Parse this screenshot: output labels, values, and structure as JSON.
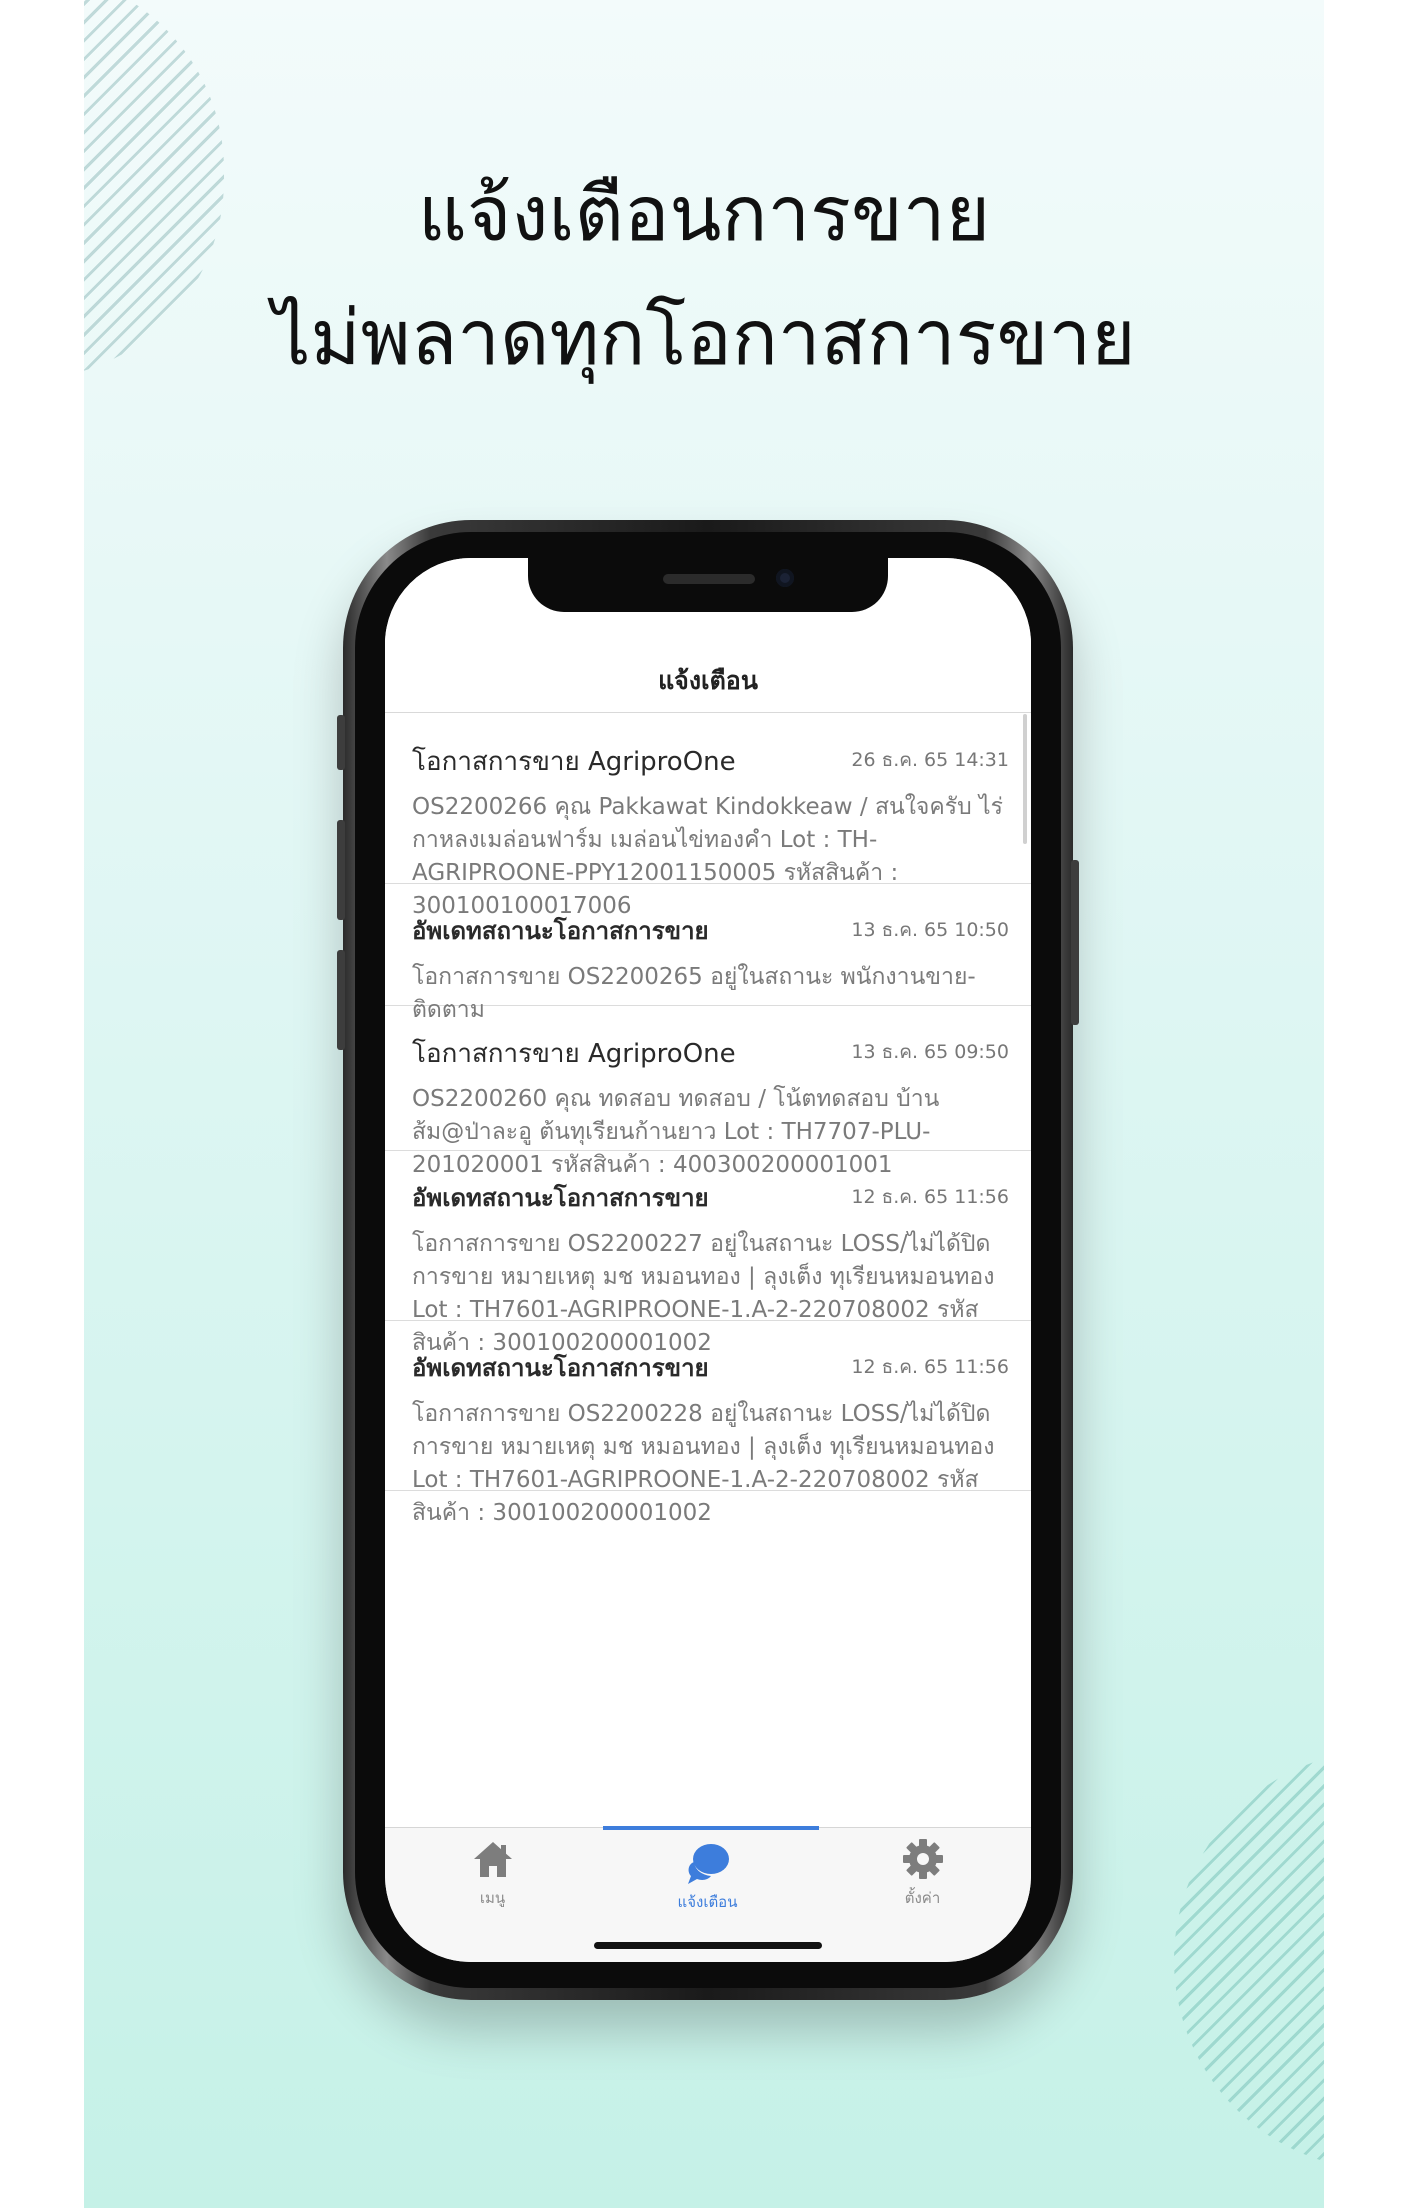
{
  "promo": {
    "headline_line1": "แจ้งเตือนการขาย",
    "headline_line2": "ไม่พลาดทุกโอกาสการขาย"
  },
  "app": {
    "title": "แจ้งเตือน",
    "notifications": [
      {
        "title": "โอกาสการขาย AgriproOne",
        "date": "26 ธ.ค. 65 14:31",
        "body": "OS2200266 คุณ Pakkawat Kindokkeaw / สนใจครับ ไร่กาหลงเมล่อนฟาร์ม เมล่อนไข่ทองคำ Lot : TH-AGRIPROONE-PPY12001150005 รหัสสินค้า : 300100100017006"
      },
      {
        "title": "อัพเดทสถานะโอกาสการขาย",
        "date": "13 ธ.ค. 65 10:50",
        "body": "โอกาสการขาย OS2200265 อยู่ในสถานะ พนักงานขาย-ติดตาม"
      },
      {
        "title": "โอกาสการขาย AgriproOne",
        "date": "13 ธ.ค. 65 09:50",
        "body": "OS2200260 คุณ ทดสอบ ทดสอบ / โน้ตทดสอบ บ้านส้ม@ป่าละอู ต้นทุเรียนก้านยาว Lot : TH7707-PLU-201020001 รหัสสินค้า : 400300200001001"
      },
      {
        "title": "อัพเดทสถานะโอกาสการขาย",
        "date": "12 ธ.ค. 65 11:56",
        "body": "โอกาสการขาย OS2200227 อยู่ในสถานะ LOSS/ไม่ได้ปิดการขาย หมายเหตุ มช หมอนทอง | ลุงเต็ง ทุเรียนหมอนทอง Lot : TH7601-AGRIPROONE-1.A-2-220708002 รหัสสินค้า : 300100200001002"
      },
      {
        "title": "อัพเดทสถานะโอกาสการขาย",
        "date": "12 ธ.ค. 65 11:56",
        "body": "โอกาสการขาย OS2200228 อยู่ในสถานะ LOSS/ไม่ได้ปิดการขาย หมายเหตุ มช หมอนทอง | ลุงเต็ง ทุเรียนหมอนทอง Lot : TH7601-AGRIPROONE-1.A-2-220708002 รหัสสินค้า : 300100200001002"
      }
    ],
    "tabs": {
      "menu_label": "เมนู",
      "menu_icon": "home-icon",
      "notify_label": "แจ้งเตือน",
      "notify_icon": "chat-bubble-icon",
      "settings_label": "ตั้งค่า",
      "settings_icon": "gear-icon"
    },
    "colors": {
      "accent": "#3d7ddc",
      "inactive_icon": "#7d7d7d"
    }
  }
}
